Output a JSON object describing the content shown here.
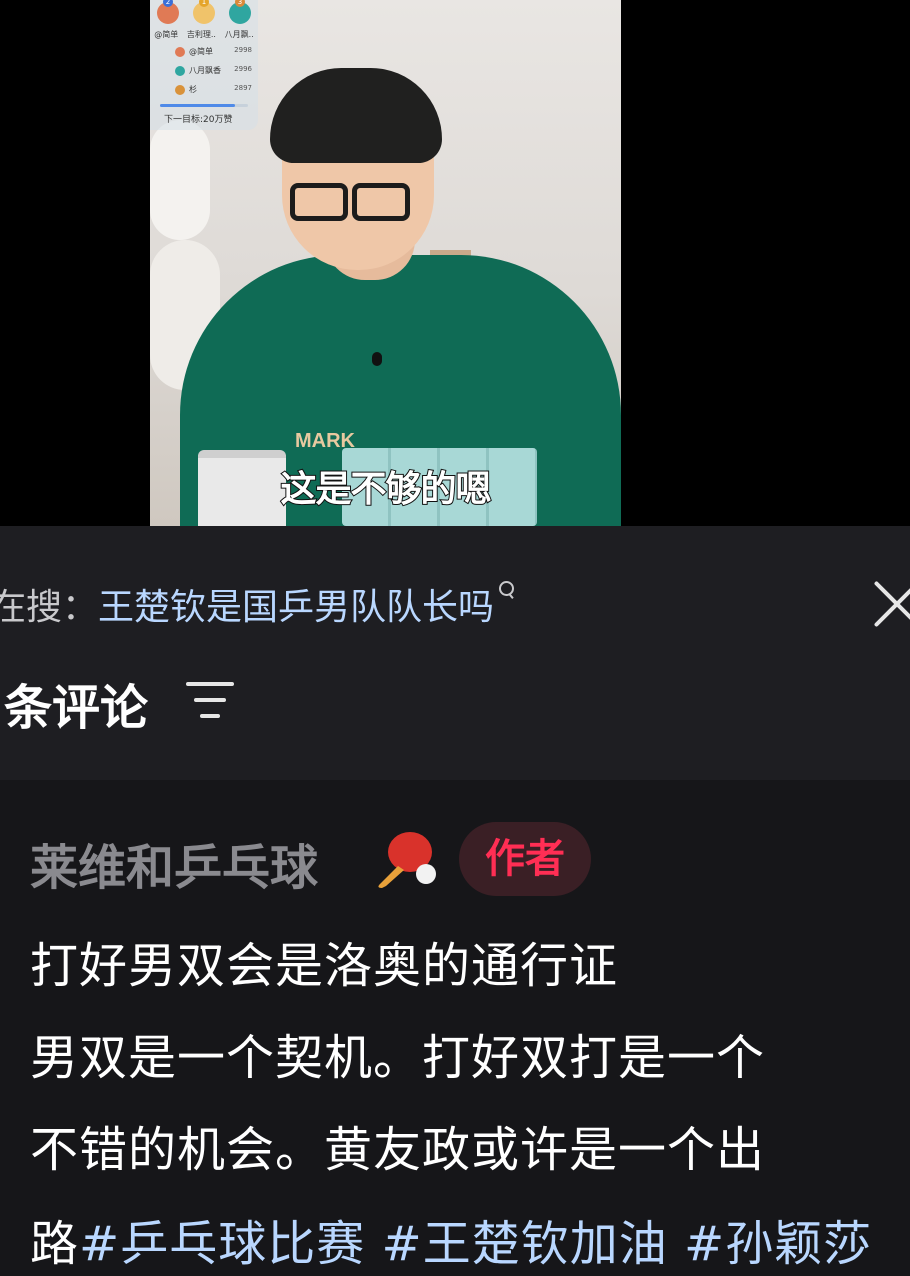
{
  "video": {
    "leaderboard": {
      "top3": [
        {
          "rank": "2",
          "name": "@简单",
          "color": "#e07a55"
        },
        {
          "rank": "1",
          "name": "吉利理..",
          "color": "#f0c36a"
        },
        {
          "rank": "3",
          "name": "八月飘..",
          "color": "#2fa6a0"
        }
      ],
      "rows": [
        {
          "name": "@简单",
          "score": "2998",
          "color": "#e07a55"
        },
        {
          "name": "八月飘香",
          "score": "2996",
          "color": "#2fa6a0"
        },
        {
          "name": "杉",
          "score": "2897",
          "color": "#d9923a"
        }
      ],
      "progress": 0.85,
      "goal": "下一目标:20万赞"
    },
    "shirt_print": "MARK",
    "subtitle": "这是不够的嗯"
  },
  "search": {
    "prefix": "在搜：",
    "query": "王楚钦是国乒男队队长吗"
  },
  "comments_header": {
    "count_label": "条评论"
  },
  "comment": {
    "user": "莱维和乒乓球",
    "author_badge": "作者",
    "lines": [
      "打好男双会是洛奥的通行证",
      "男双是一个契机。打好双打是一个",
      "不错的机会。黄友政或许是一个出"
    ],
    "last_line_text": "路",
    "hashtags": [
      "#乒乓球比赛",
      "#王楚钦加油",
      "#孙颖莎"
    ]
  },
  "colors": {
    "sheet_bg": "#1e1e22",
    "comment_bg": "#161619",
    "hashtag": "#b9d7ff",
    "author_badge_text": "#ff2e54",
    "author_badge_bg": "#3a1f25"
  }
}
